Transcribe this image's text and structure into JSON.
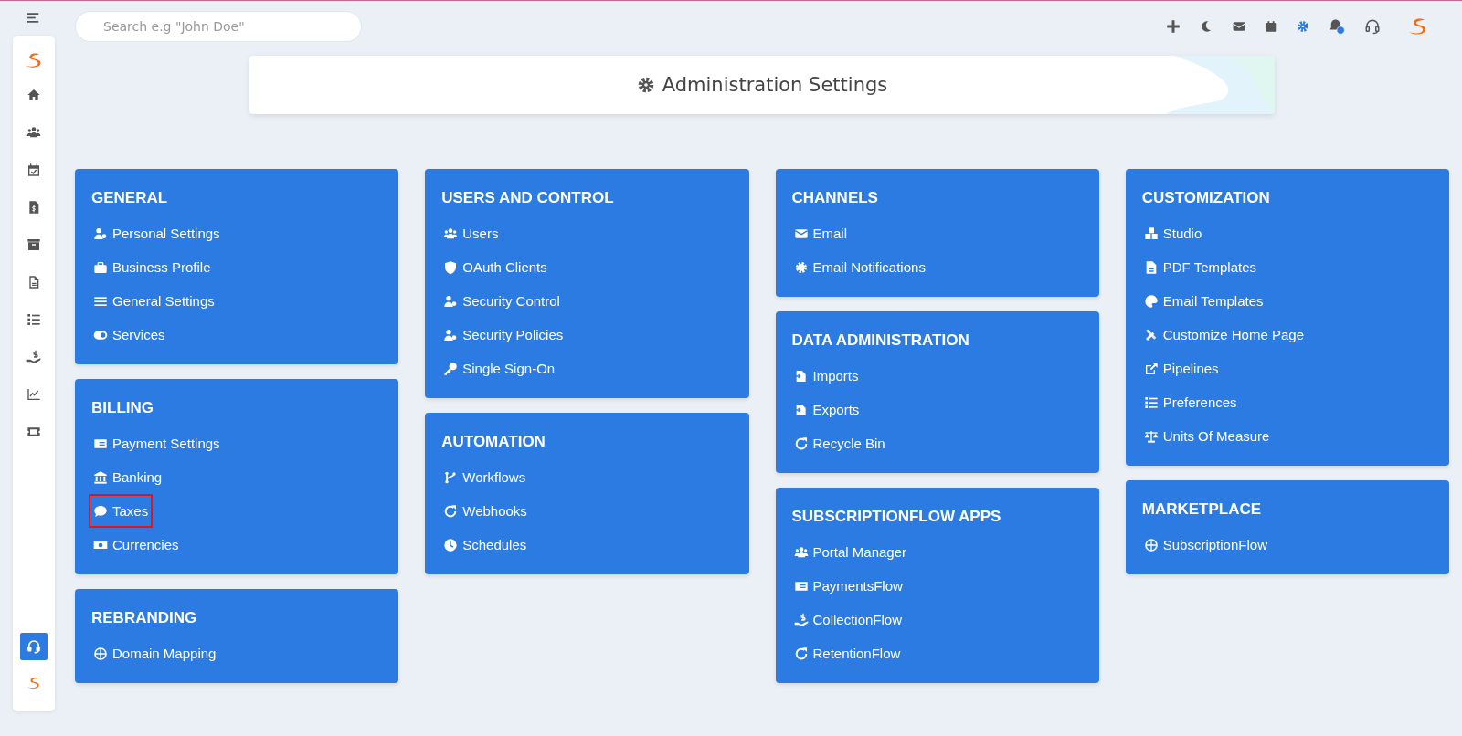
{
  "search": {
    "placeholder": "Search e.g \"John Doe\""
  },
  "toolbar": {
    "settings_selected": true,
    "notification_dot": true
  },
  "sidebar": {
    "items": [
      {
        "selected": false
      },
      {
        "selected": false
      },
      {
        "selected": false
      },
      {
        "selected": false
      },
      {
        "selected": false
      },
      {
        "selected": false
      },
      {
        "selected": false
      },
      {
        "selected": false
      },
      {
        "selected": false
      },
      {
        "selected": false
      }
    ],
    "support_selected": true
  },
  "page_title": "Administration Settings",
  "columns": [
    {
      "cards": [
        {
          "title": "GENERAL",
          "items": [
            {
              "label": "Personal Settings",
              "highlighted": false
            },
            {
              "label": "Business Profile",
              "highlighted": false
            },
            {
              "label": "General Settings",
              "highlighted": false
            },
            {
              "label": "Services",
              "highlighted": false
            }
          ]
        },
        {
          "title": "BILLING",
          "items": [
            {
              "label": "Payment Settings",
              "highlighted": false
            },
            {
              "label": "Banking",
              "highlighted": false
            },
            {
              "label": "Taxes",
              "highlighted": true
            },
            {
              "label": "Currencies",
              "highlighted": false
            }
          ]
        },
        {
          "title": "REBRANDING",
          "items": [
            {
              "label": "Domain Mapping",
              "highlighted": false
            }
          ]
        }
      ]
    },
    {
      "cards": [
        {
          "title": "USERS AND CONTROL",
          "items": [
            {
              "label": "Users",
              "highlighted": false
            },
            {
              "label": "OAuth Clients",
              "highlighted": false
            },
            {
              "label": "Security Control",
              "highlighted": false
            },
            {
              "label": "Security Policies",
              "highlighted": false
            },
            {
              "label": "Single Sign-On",
              "highlighted": false
            }
          ]
        },
        {
          "title": "AUTOMATION",
          "items": [
            {
              "label": "Workflows",
              "highlighted": false
            },
            {
              "label": "Webhooks",
              "highlighted": false
            },
            {
              "label": "Schedules",
              "highlighted": false
            }
          ]
        }
      ]
    },
    {
      "cards": [
        {
          "title": "CHANNELS",
          "items": [
            {
              "label": "Email",
              "highlighted": false
            },
            {
              "label": "Email Notifications",
              "highlighted": false
            }
          ]
        },
        {
          "title": "DATA ADMINISTRATION",
          "items": [
            {
              "label": "Imports",
              "highlighted": false
            },
            {
              "label": "Exports",
              "highlighted": false
            },
            {
              "label": "Recycle Bin",
              "highlighted": false
            }
          ]
        },
        {
          "title": "SUBSCRIPTIONFLOW APPS",
          "items": [
            {
              "label": "Portal Manager",
              "highlighted": false
            },
            {
              "label": "PaymentsFlow",
              "highlighted": false
            },
            {
              "label": "CollectionFlow",
              "highlighted": false
            },
            {
              "label": "RetentionFlow",
              "highlighted": false
            }
          ]
        }
      ]
    },
    {
      "cards": [
        {
          "title": "CUSTOMIZATION",
          "items": [
            {
              "label": "Studio",
              "highlighted": false
            },
            {
              "label": "PDF Templates",
              "highlighted": false
            },
            {
              "label": "Email Templates",
              "highlighted": false
            },
            {
              "label": "Customize Home Page",
              "highlighted": false
            },
            {
              "label": "Pipelines",
              "highlighted": false
            },
            {
              "label": "Preferences",
              "highlighted": false
            },
            {
              "label": "Units Of Measure",
              "highlighted": false
            }
          ]
        },
        {
          "title": "MARKETPLACE",
          "items": [
            {
              "label": "SubscriptionFlow",
              "highlighted": false
            }
          ]
        }
      ]
    }
  ]
}
